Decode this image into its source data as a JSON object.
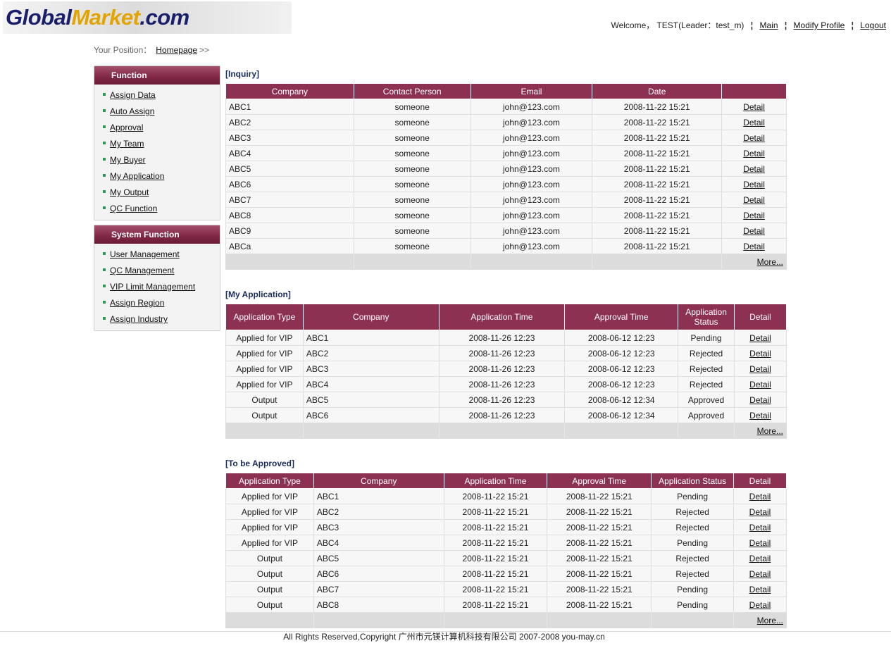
{
  "logo": {
    "part1": "Global",
    "part2": "Market",
    "part3": ".com"
  },
  "topnav": {
    "welcome": "Welcome， TEST(Leader：test_m)",
    "sep": "¦",
    "main": "Main",
    "modify_profile": "Modify Profile",
    "logout": "Logout"
  },
  "breadcrumb": {
    "label": "Your Position：",
    "home": "Homepage",
    "arrow": ">>"
  },
  "sidebar": {
    "function": {
      "title": "Function",
      "items": [
        "Assign Data",
        "Auto Assign",
        "Approval",
        "My Team",
        "My Buyer",
        "My Application",
        "My Output",
        "QC Function"
      ]
    },
    "system": {
      "title": "System Function",
      "items": [
        "User Management",
        "QC Management",
        "VIP Limit Management",
        "Assign Region",
        "Assign Industry"
      ]
    }
  },
  "inquiry": {
    "title": "[Inquiry]",
    "headers": [
      "Company",
      "Contact Person",
      "Email",
      "Date",
      ""
    ],
    "rows": [
      [
        "ABC1",
        "someone",
        "john@123.com",
        "2008-11-22 15:21",
        "Detail"
      ],
      [
        "ABC2",
        "someone",
        "john@123.com",
        "2008-11-22 15:21",
        "Detail"
      ],
      [
        "ABC3",
        "someone",
        "john@123.com",
        "2008-11-22 15:21",
        "Detail"
      ],
      [
        "ABC4",
        "someone",
        "john@123.com",
        "2008-11-22 15:21",
        "Detail"
      ],
      [
        "ABC5",
        "someone",
        "john@123.com",
        "2008-11-22 15:21",
        "Detail"
      ],
      [
        "ABC6",
        "someone",
        "john@123.com",
        "2008-11-22 15:21",
        "Detail"
      ],
      [
        "ABC7",
        "someone",
        "john@123.com",
        "2008-11-22 15:21",
        "Detail"
      ],
      [
        "ABC8",
        "someone",
        "john@123.com",
        "2008-11-22 15:21",
        "Detail"
      ],
      [
        "ABC9",
        "someone",
        "john@123.com",
        "2008-11-22 15:21",
        "Detail"
      ],
      [
        "ABCa",
        "someone",
        "john@123.com",
        "2008-11-22 15:21",
        "Detail"
      ]
    ],
    "more": "More..."
  },
  "my_application": {
    "title": "[My Application]",
    "headers": [
      "Application Type",
      "Company",
      "Application Time",
      "Approval Time",
      "Application Status",
      "Detail"
    ],
    "rows": [
      [
        "Applied for VIP",
        "ABC1",
        "2008-11-26 12:23",
        "2008-06-12 12:23",
        "Pending",
        "Detail"
      ],
      [
        "Applied for VIP",
        "ABC2",
        "2008-11-26 12:23",
        "2008-06-12 12:23",
        "Rejected",
        "Detail"
      ],
      [
        "Applied for VIP",
        "ABC3",
        "2008-11-26 12:23",
        "2008-06-12 12:23",
        "Rejected",
        "Detail"
      ],
      [
        "Applied for VIP",
        "ABC4",
        "2008-11-26 12:23",
        "2008-06-12 12:23",
        "Rejected",
        "Detail"
      ],
      [
        "Output",
        "ABC5",
        "2008-11-26 12:23",
        "2008-06-12 12:34",
        "Approved",
        "Detail"
      ],
      [
        "Output",
        "ABC6",
        "2008-11-26 12:23",
        "2008-06-12 12:34",
        "Approved",
        "Detail"
      ]
    ],
    "more": "More..."
  },
  "to_be_approved": {
    "title": "[To be Approved]",
    "headers": [
      "Application Type",
      "Company",
      "Application Time",
      "Approval Time",
      "Application Status",
      "Detail"
    ],
    "rows": [
      [
        "Applied for VIP",
        "ABC1",
        "2008-11-22 15:21",
        "2008-11-22 15:21",
        "Pending",
        "Detail"
      ],
      [
        "Applied for VIP",
        "ABC2",
        "2008-11-22 15:21",
        "2008-11-22 15:21",
        "Rejected",
        "Detail"
      ],
      [
        "Applied for VIP",
        "ABC3",
        "2008-11-22 15:21",
        "2008-11-22 15:21",
        "Rejected",
        "Detail"
      ],
      [
        "Applied for VIP",
        "ABC4",
        "2008-11-22 15:21",
        "2008-11-22 15:21",
        "Pending",
        "Detail"
      ],
      [
        "Output",
        "ABC5",
        "2008-11-22 15:21",
        "2008-11-22 15:21",
        "Rejected",
        "Detail"
      ],
      [
        "Output",
        "ABC6",
        "2008-11-22 15:21",
        "2008-11-22 15:21",
        "Rejected",
        "Detail"
      ],
      [
        "Output",
        "ABC7",
        "2008-11-22 15:21",
        "2008-11-22 15:21",
        "Pending",
        "Detail"
      ],
      [
        "Output",
        "ABC8",
        "2008-11-22 15:21",
        "2008-11-22 15:21",
        "Pending",
        "Detail"
      ]
    ],
    "more": "More..."
  },
  "footer": {
    "text": "All Rights Reserved,Copyright 广州市元镁计算机科技有限公司 2007-2008 you-may.cn"
  },
  "colors": {
    "header_bg": "#8c3152",
    "sidebar_head": "#7f2745",
    "bullet": "#2c9a52",
    "logo_blue": "#1a1f6b",
    "logo_gold": "#e3a400"
  }
}
